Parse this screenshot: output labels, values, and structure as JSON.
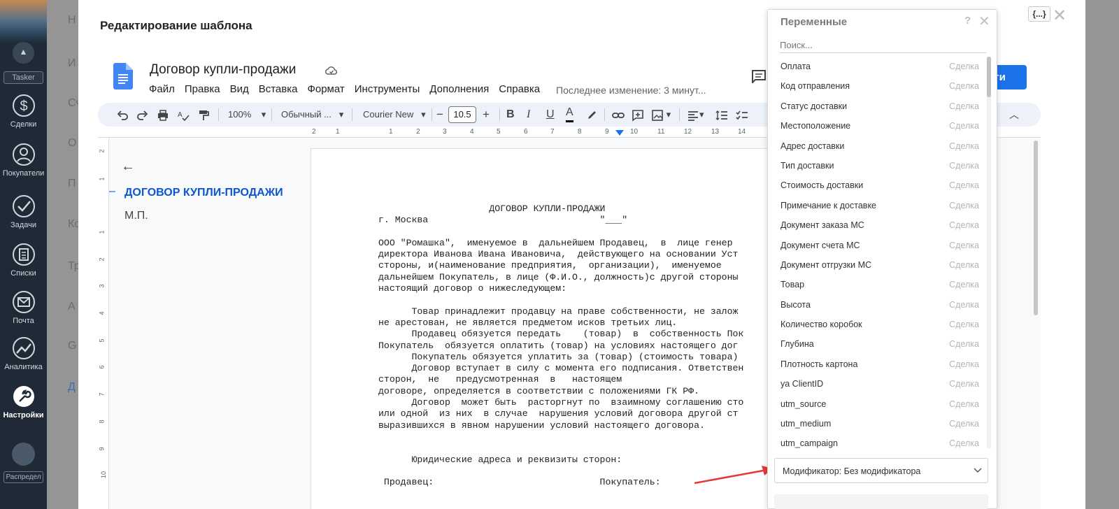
{
  "app_nav": {
    "tasker_label": "Tasker",
    "items": [
      {
        "label": "Сделки",
        "icon": "dollar-icon"
      },
      {
        "label": "Покупатели",
        "icon": "users-icon"
      },
      {
        "label": "Задачи",
        "icon": "check-circle-icon"
      },
      {
        "label": "Списки",
        "icon": "list-icon"
      },
      {
        "label": "Почта",
        "icon": "mail-icon"
      },
      {
        "label": "Аналитика",
        "icon": "analytics-icon"
      },
      {
        "label": "Настройки",
        "icon": "wrench-icon"
      }
    ],
    "distribution_label": "Распредел"
  },
  "background_panel": {
    "items": [
      "Н",
      "И",
      "Сч",
      "О",
      "П",
      "Ко",
      "Тр",
      "А",
      "G",
      "Д"
    ]
  },
  "modal": {
    "title": "Редактирование шаблона",
    "close_glyph": "✕",
    "variables_button": "{...}"
  },
  "docs": {
    "document_name": "Договор купли-продажи",
    "menu": [
      "Файл",
      "Правка",
      "Вид",
      "Вставка",
      "Формат",
      "Инструменты",
      "Дополнения",
      "Справка"
    ],
    "last_edit": "Последнее изменение: 3 минут...",
    "access_button": "йти",
    "toolbar": {
      "zoom": "100%",
      "style": "Обычный ...",
      "font": "Courier New",
      "font_size": "10.5",
      "bold": "B",
      "italic": "I",
      "underline": "U",
      "text_color": "A"
    },
    "ruler_numbers": [
      "2",
      "1",
      "1",
      "2",
      "3",
      "4",
      "5",
      "6",
      "7",
      "8",
      "9",
      "10",
      "11",
      "12",
      "13",
      "14"
    ],
    "vruler_numbers": [
      "2",
      "1",
      "1",
      "2",
      "3",
      "4",
      "5",
      "6",
      "7",
      "8",
      "9",
      "10"
    ]
  },
  "outline": {
    "items": [
      "ДОГОВОР КУПЛИ-ПРОДАЖИ",
      "М.П."
    ]
  },
  "document_body": {
    "lines": [
      "                    ДОГОВОР КУПЛИ-ПРОДАЖИ",
      "г. Москва                               \"___\"",
      "",
      "ООО \"Ромашка\",  именуемое в  дальнейшем Продавец,  в  лице генер",
      "директора Иванова Ивана Ивановича,  действующего на основании Уст",
      "стороны, и(наименование предприятия,  организации),  именуемое",
      "дальнейшем Покупатель, в лице (Ф.И.О., должность)с другой стороны",
      "настоящий договор о нижеследующем:",
      "",
      "      Товар принадлежит продавцу на праве собственности, не залож",
      "не арестован, не является предметом исков третьих лиц.",
      "      Продавец обязуется передать    (товар)  в  собственность Пок",
      "Покупатель  обязуется оплатить (товар) на условиях настоящего дог",
      "      Покупатель обязуется уплатить за (товар) (стоимость товара)",
      "      Договор вступает в силу с момента его подписания. Ответствен",
      "сторон,  не   предусмотренная  в   настоящем",
      "договоре, определяется в соответствии с положениями ГК РФ.",
      "      Договор  может быть  расторгнут по  взаимному соглашению сто",
      "или одной  из них  в случае  нарушения условий договора другой ст",
      "выразившихся в явном нарушении условий настоящего договора.",
      "",
      "",
      "      Юридические адреса и реквизиты сторон:",
      "",
      " Продавец:                              Покупатель:"
    ]
  },
  "variables_panel": {
    "title": "Переменные",
    "help_glyph": "?",
    "close_glyph": "✕",
    "search_placeholder": "Поиск...",
    "items": [
      {
        "name": "Оплата",
        "type": "Сделка"
      },
      {
        "name": "Код отправления",
        "type": "Сделка"
      },
      {
        "name": "Статус доставки",
        "type": "Сделка"
      },
      {
        "name": "Местоположение",
        "type": "Сделка"
      },
      {
        "name": "Адрес доставки",
        "type": "Сделка"
      },
      {
        "name": "Тип доставки",
        "type": "Сделка"
      },
      {
        "name": "Стоимость доставки",
        "type": "Сделка"
      },
      {
        "name": "Примечание к доставке",
        "type": "Сделка"
      },
      {
        "name": "Документ заказа МС",
        "type": "Сделка"
      },
      {
        "name": "Документ счета МС",
        "type": "Сделка"
      },
      {
        "name": "Документ отгрузки МС",
        "type": "Сделка"
      },
      {
        "name": "Товар",
        "type": "Сделка"
      },
      {
        "name": "Высота",
        "type": "Сделка"
      },
      {
        "name": "Количество коробок",
        "type": "Сделка"
      },
      {
        "name": "Глубина",
        "type": "Сделка"
      },
      {
        "name": "Плотность картона",
        "type": "Сделка"
      },
      {
        "name": "ya ClientID",
        "type": "Сделка"
      },
      {
        "name": "utm_source",
        "type": "Сделка"
      },
      {
        "name": "utm_medium",
        "type": "Сделка"
      },
      {
        "name": "utm_campaign",
        "type": "Сделка"
      }
    ],
    "modifier_label": "Модификатор: Без модификатора"
  },
  "colors": {
    "accent": "#1a73e8",
    "outline_active": "#0b57d0",
    "annotation_arrow": "#e53935",
    "sidebar": "#1f2a36"
  }
}
